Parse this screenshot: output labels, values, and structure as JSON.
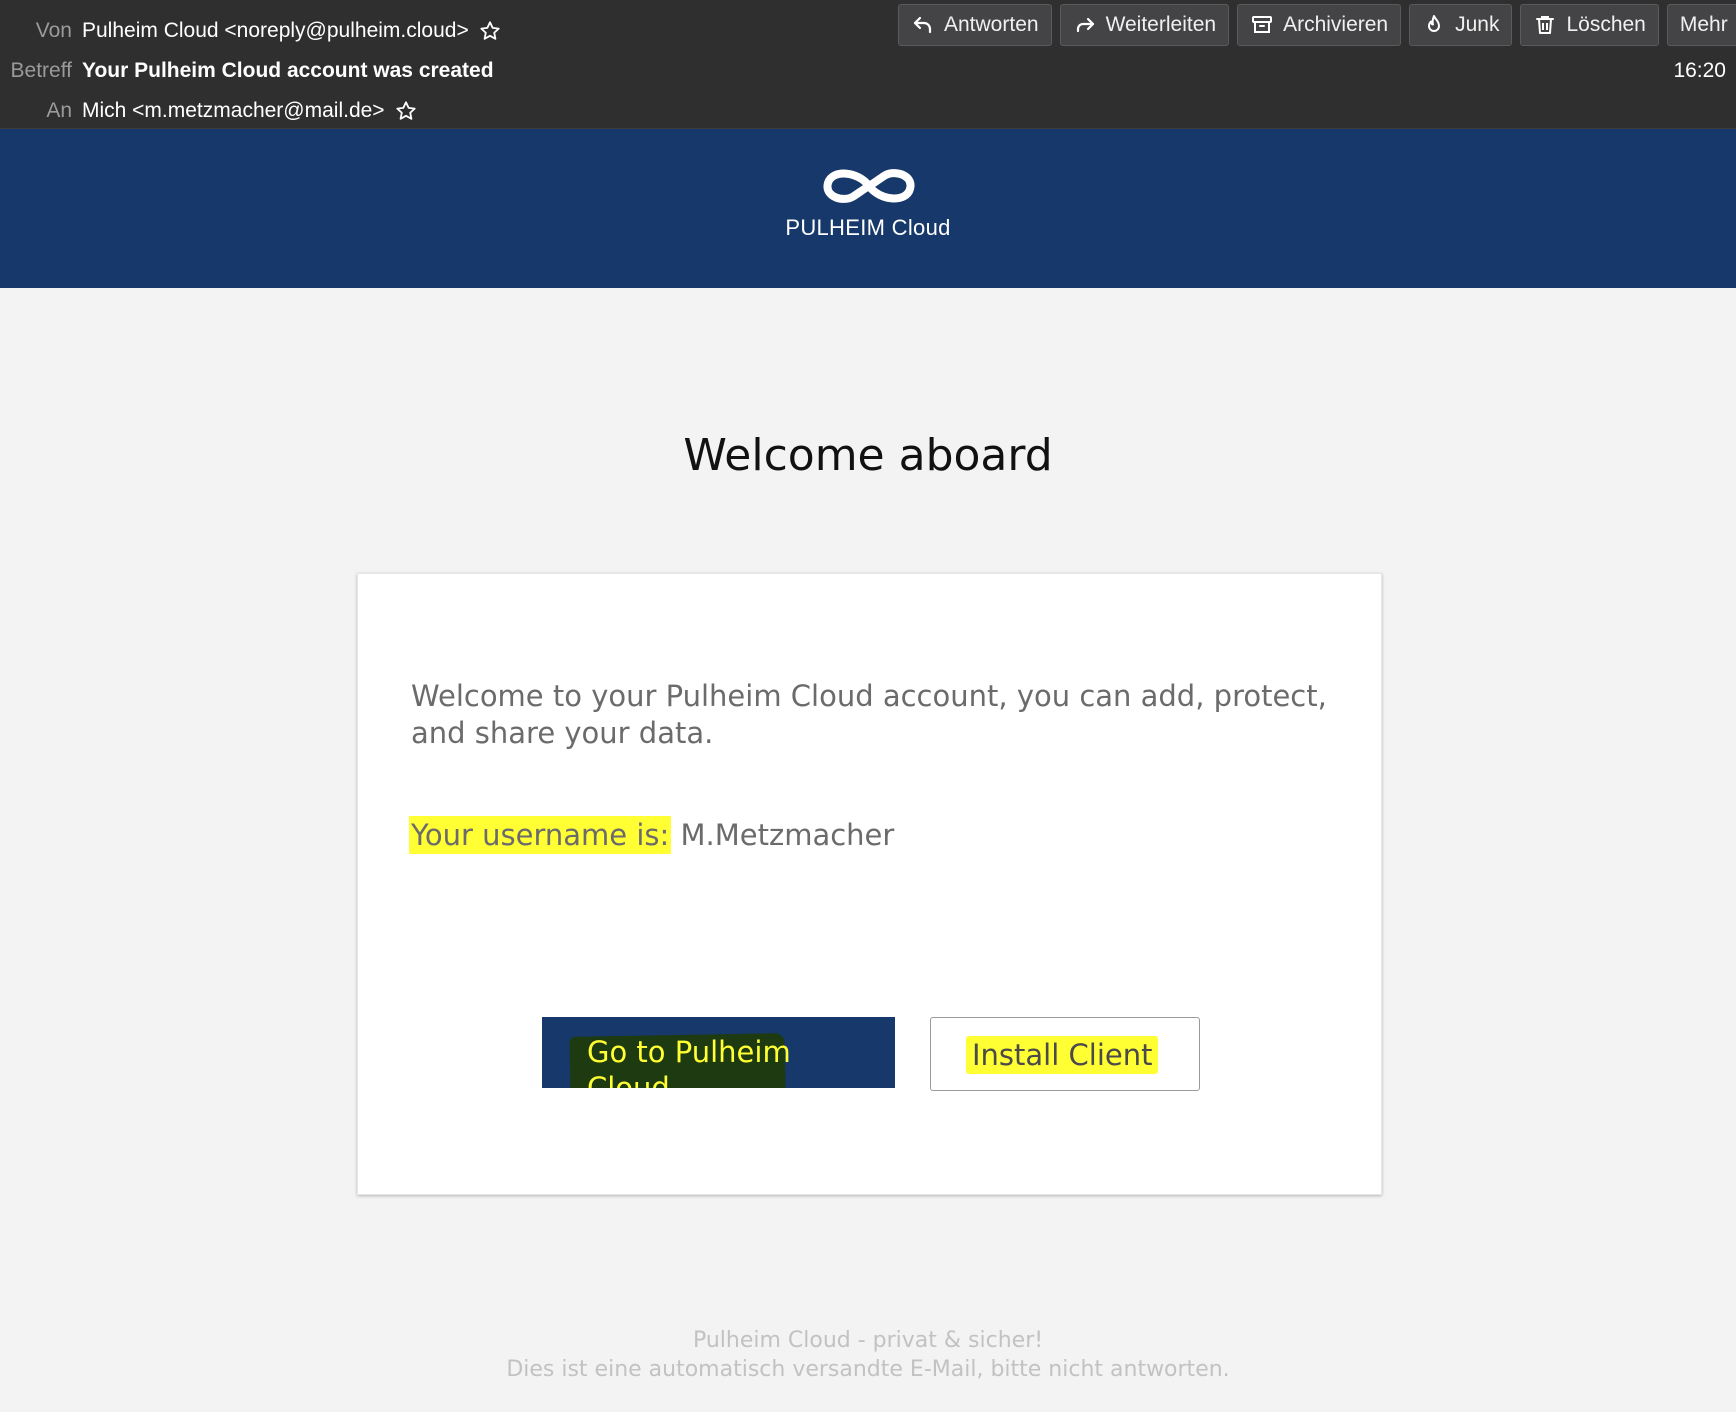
{
  "header": {
    "from_label": "Von",
    "from_value": "Pulheim Cloud <noreply@pulheim.cloud>",
    "subject_label": "Betreff",
    "subject_value": "Your Pulheim Cloud account was created",
    "to_label": "An",
    "to_value": "Mich <m.metzmacher@mail.de>",
    "time": "16:20"
  },
  "toolbar": {
    "reply": "Antworten",
    "forward": "Weiterleiten",
    "archive": "Archivieren",
    "junk": "Junk",
    "delete": "Löschen",
    "more": "Mehr"
  },
  "banner": {
    "brand": "PULHEIM Cloud"
  },
  "email": {
    "title": "Welcome aboard",
    "intro": "Welcome to your Pulheim Cloud account, you can add, protect, and share your data.",
    "username_label": "Your username is:",
    "username_value": "M.Metzmacher",
    "primary_button": "Go to Pulheim Cloud",
    "secondary_button": "Install Client"
  },
  "footer": {
    "line1": "Pulheim Cloud - privat & sicher!",
    "line2": "Dies ist eine automatisch versandte E-Mail, bitte nicht antworten."
  },
  "colors": {
    "header_bg": "#2f2f30",
    "banner_bg": "#17386a",
    "highlight": "#ffff33",
    "page_bg": "#f3f3f3"
  }
}
